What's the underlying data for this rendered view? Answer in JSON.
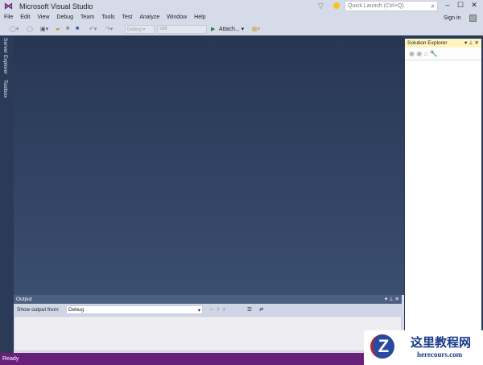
{
  "app": {
    "title": "Microsoft Visual Studio",
    "logo": "vs-logo"
  },
  "titlebar": {
    "quick_launch_placeholder": "Quick Launch (Ctrl+Q)",
    "sign_in": "Sign in",
    "minimize": "‒",
    "maximize": "☐",
    "close": "✕"
  },
  "menu": [
    "File",
    "Edit",
    "View",
    "Debug",
    "Team",
    "Tools",
    "Test",
    "Analyze",
    "Window",
    "Help"
  ],
  "toolbar": {
    "config": "Debug",
    "platform": "x86",
    "attach": "Attach..."
  },
  "side_tabs": [
    "Server Explorer",
    "Toolbox"
  ],
  "solution_explorer": {
    "title": "Solution Explorer"
  },
  "output": {
    "title": "Output",
    "show_from_label": "Show output from:",
    "source": "Debug"
  },
  "status": {
    "text": "Ready",
    "color": "#68217a"
  },
  "watermark": {
    "cn": "这里教程网",
    "url": "herecours.com"
  }
}
